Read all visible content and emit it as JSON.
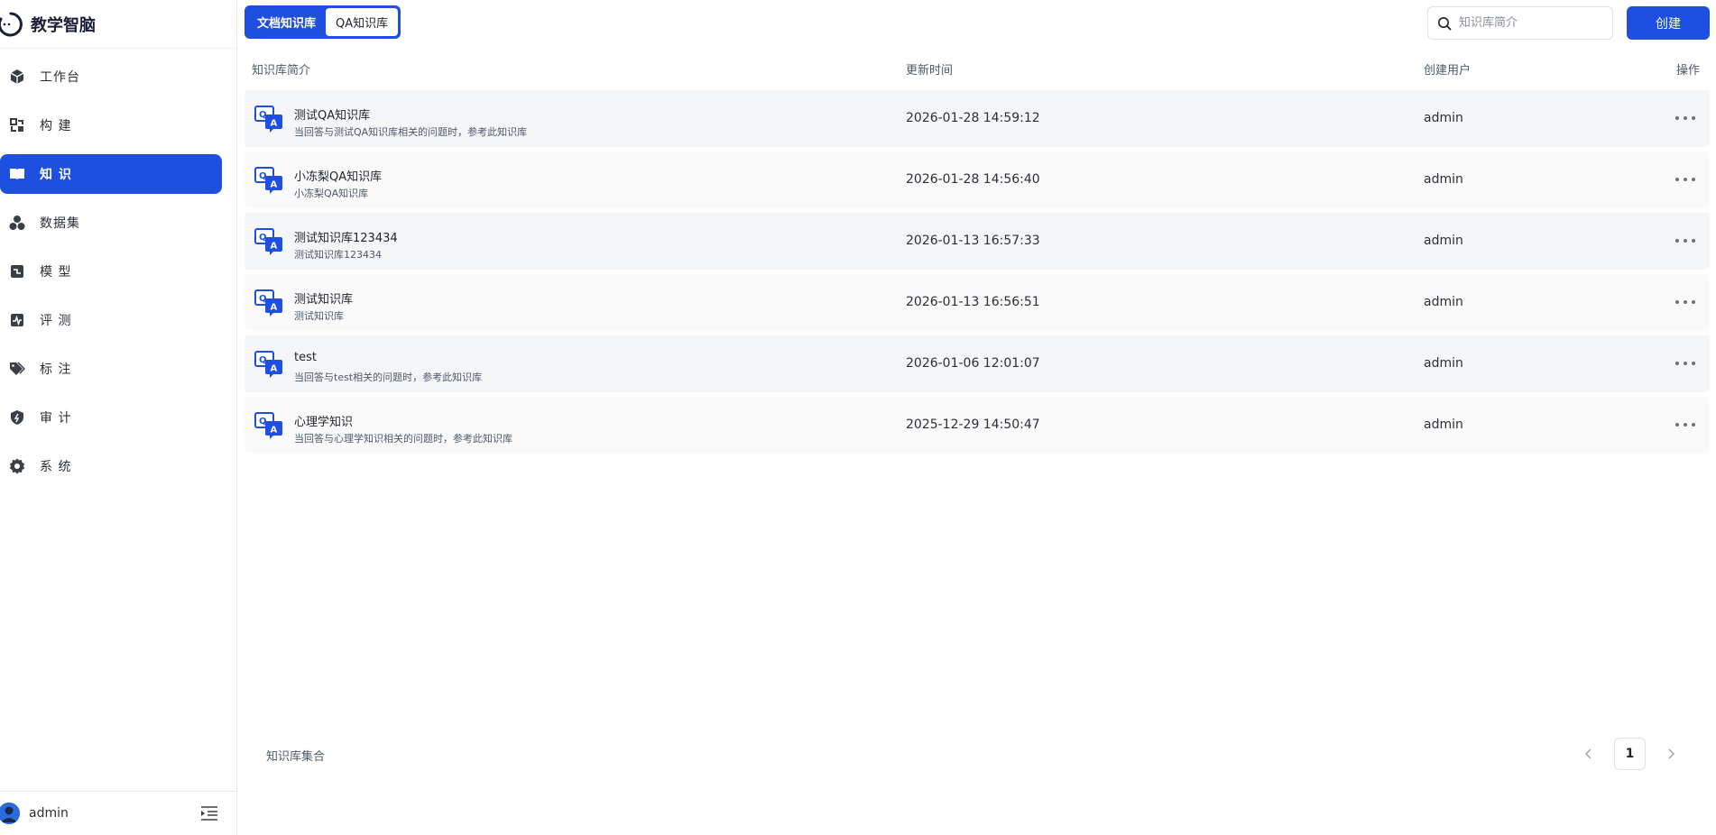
{
  "app": {
    "title": "教学智脑"
  },
  "sidebar": {
    "items": [
      {
        "label": "工作台",
        "icon": "cube-icon",
        "active": false
      },
      {
        "label": "构 建",
        "icon": "build-icon",
        "active": false
      },
      {
        "label": "知 识",
        "icon": "book-icon",
        "active": true
      },
      {
        "label": "数据集",
        "icon": "dataset-icon",
        "active": false
      },
      {
        "label": "模 型",
        "icon": "model-icon",
        "active": false
      },
      {
        "label": "评 测",
        "icon": "evaluate-icon",
        "active": false
      },
      {
        "label": "标 注",
        "icon": "tag-icon",
        "active": false
      },
      {
        "label": "审 计",
        "icon": "shield-icon",
        "active": false
      },
      {
        "label": "系 统",
        "icon": "gear-icon",
        "active": false
      }
    ],
    "user": "admin"
  },
  "tabs": {
    "doc": "文档知识库",
    "qa": "QA知识库"
  },
  "search": {
    "placeholder": "知识库简介"
  },
  "toolbar": {
    "create_label": "创建"
  },
  "table": {
    "headers": {
      "intro": "知识库简介",
      "updated": "更新时间",
      "creator": "创建用户",
      "actions": "操作"
    },
    "rows": [
      {
        "name": "测试QA知识库",
        "desc": "当回答与测试QA知识库相关的问题时，参考此知识库",
        "time": "2026-01-28 14:59:12",
        "user": "admin"
      },
      {
        "name": "小冻梨QA知识库",
        "desc": "小冻梨QA知识库",
        "time": "2026-01-28 14:56:40",
        "user": "admin"
      },
      {
        "name": "测试知识库123434",
        "desc": "测试知识库123434",
        "time": "2026-01-13 16:57:33",
        "user": "admin"
      },
      {
        "name": "测试知识库",
        "desc": "测试知识库",
        "time": "2026-01-13 16:56:51",
        "user": "admin"
      },
      {
        "name": "test",
        "desc": "当回答与test相关的问题时，参考此知识库",
        "time": "2026-01-06 12:01:07",
        "user": "admin"
      },
      {
        "name": "心理学知识",
        "desc": "当回答与心理学知识相关的问题时，参考此知识库",
        "time": "2025-12-29 14:50:47",
        "user": "admin"
      }
    ]
  },
  "footer": {
    "label": "知识库集合",
    "page": "1"
  },
  "colors": {
    "accent": "#1f4fe0"
  }
}
